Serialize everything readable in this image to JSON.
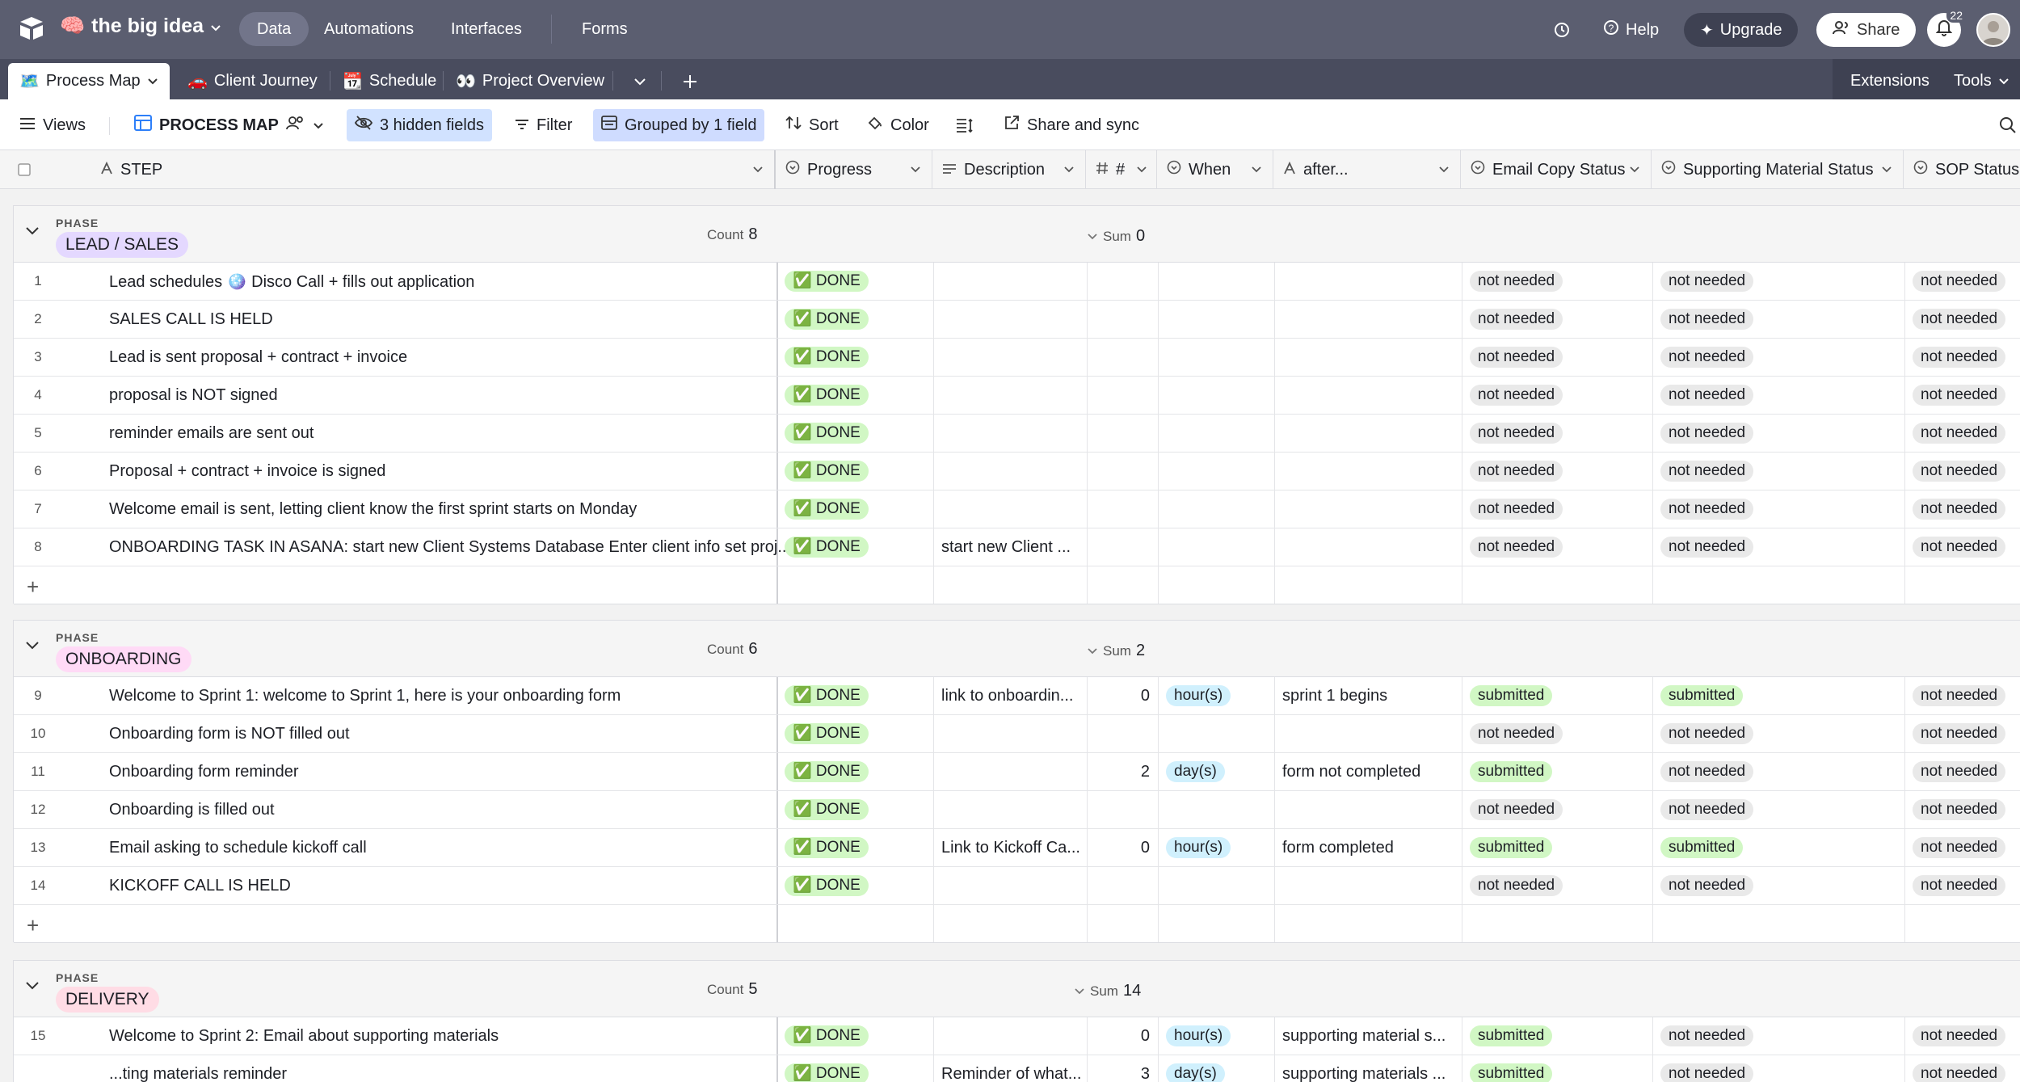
{
  "topbar": {
    "base_name": "the big idea",
    "nav": [
      "Data",
      "Automations",
      "Interfaces",
      "Forms"
    ],
    "help": "Help",
    "upgrade": "Upgrade",
    "share": "Share",
    "notifications": "22"
  },
  "tabs": {
    "items": [
      "Process Map",
      "Client Journey",
      "Schedule",
      "Project Overview"
    ],
    "extensions": "Extensions",
    "tools": "Tools"
  },
  "viewbar": {
    "views": "Views",
    "view_name": "PROCESS MAP",
    "hidden_fields": "3 hidden fields",
    "filter": "Filter",
    "grouped": "Grouped by 1 field",
    "sort": "Sort",
    "color": "Color",
    "share_sync": "Share and sync"
  },
  "columns": [
    "STEP",
    "Progress",
    "Description",
    "#",
    "When",
    "after...",
    "Email Copy Status",
    "Supporting Material Status",
    "SOP Status"
  ],
  "group_meta": {
    "phase_label": "PHASE",
    "count_label": "Count",
    "sum_label": "Sum"
  },
  "groups": [
    {
      "name": "LEAD / SALES",
      "color": "#e4d8ff",
      "count": "8",
      "sum": "0",
      "rows": [
        {
          "n": "1",
          "step": "Lead schedules 🪩 Disco Call + fills out application",
          "progress": "✅ DONE",
          "desc": "",
          "num": "",
          "when": "",
          "after": "",
          "email": "not needed",
          "support": "not needed",
          "sop": "not needed"
        },
        {
          "n": "2",
          "step": "SALES CALL IS HELD",
          "progress": "✅ DONE",
          "desc": "",
          "num": "",
          "when": "",
          "after": "",
          "email": "not needed",
          "support": "not needed",
          "sop": "not needed"
        },
        {
          "n": "3",
          "step": "Lead is sent proposal + contract + invoice",
          "progress": "✅ DONE",
          "desc": "",
          "num": "",
          "when": "",
          "after": "",
          "email": "not needed",
          "support": "not needed",
          "sop": "not needed"
        },
        {
          "n": "4",
          "step": "proposal is NOT signed",
          "progress": "✅ DONE",
          "desc": "",
          "num": "",
          "when": "",
          "after": "",
          "email": "not needed",
          "support": "not needed",
          "sop": "not needed"
        },
        {
          "n": "5",
          "step": "reminder emails are sent out",
          "progress": "✅ DONE",
          "desc": "",
          "num": "",
          "when": "",
          "after": "",
          "email": "not needed",
          "support": "not needed",
          "sop": "not needed"
        },
        {
          "n": "6",
          "step": "Proposal + contract + invoice is signed",
          "progress": "✅ DONE",
          "desc": "",
          "num": "",
          "when": "",
          "after": "",
          "email": "not needed",
          "support": "not needed",
          "sop": "not needed"
        },
        {
          "n": "7",
          "step": "Welcome email is sent, letting client know the first sprint starts on Monday",
          "progress": "✅ DONE",
          "desc": "",
          "num": "",
          "when": "",
          "after": "",
          "email": "not needed",
          "support": "not needed",
          "sop": "not needed"
        },
        {
          "n": "8",
          "step": "ONBOARDING TASK IN ASANA: start new Client Systems Database Enter client info set proj...",
          "progress": "✅ DONE",
          "desc": "start new Client ...",
          "num": "",
          "when": "",
          "after": "",
          "email": "not needed",
          "support": "not needed",
          "sop": "not needed"
        }
      ]
    },
    {
      "name": "ONBOARDING",
      "color": "#ffdaf6",
      "count": "6",
      "sum": "2",
      "rows": [
        {
          "n": "9",
          "step": "Welcome to Sprint 1: welcome to Sprint 1, here is your onboarding form",
          "progress": "✅ DONE",
          "desc": "link to onboardin...",
          "num": "0",
          "when": "hour(s)",
          "after": "sprint 1 begins",
          "email": "submitted",
          "support": "submitted",
          "sop": "not needed"
        },
        {
          "n": "10",
          "step": "Onboarding form is NOT filled out",
          "progress": "✅ DONE",
          "desc": "",
          "num": "",
          "when": "",
          "after": "",
          "email": "not needed",
          "support": "not needed",
          "sop": "not needed"
        },
        {
          "n": "11",
          "step": "Onboarding form reminder",
          "progress": "✅ DONE",
          "desc": "",
          "num": "2",
          "when": "day(s)",
          "after": "form not completed",
          "email": "submitted",
          "support": "not needed",
          "sop": "not needed"
        },
        {
          "n": "12",
          "step": "Onboarding is filled out",
          "progress": "✅ DONE",
          "desc": "",
          "num": "",
          "when": "",
          "after": "",
          "email": "not needed",
          "support": "not needed",
          "sop": "not needed"
        },
        {
          "n": "13",
          "step": "Email asking to schedule kickoff call",
          "progress": "✅ DONE",
          "desc": "Link to Kickoff Ca...",
          "num": "0",
          "when": "hour(s)",
          "after": "form completed",
          "email": "submitted",
          "support": "submitted",
          "sop": "not needed"
        },
        {
          "n": "14",
          "step": "KICKOFF CALL IS HELD",
          "progress": "✅ DONE",
          "desc": "",
          "num": "",
          "when": "",
          "after": "",
          "email": "not needed",
          "support": "not needed",
          "sop": "not needed"
        }
      ]
    },
    {
      "name": "DELIVERY",
      "color": "#ffdce5",
      "count": "5",
      "sum": "14",
      "rows": [
        {
          "n": "15",
          "step": "Welcome to Sprint 2: Email about supporting materials",
          "progress": "✅ DONE",
          "desc": "",
          "num": "0",
          "when": "hour(s)",
          "after": "supporting material s...",
          "email": "submitted",
          "support": "not needed",
          "sop": "not needed"
        },
        {
          "n": "",
          "step": "...ting materials reminder",
          "progress": "✅ DONE",
          "desc": "Reminder of what...",
          "num": "3",
          "when": "day(s)",
          "after": "supporting materials ...",
          "email": "submitted",
          "support": "not needed",
          "sop": "not needed"
        }
      ]
    }
  ]
}
